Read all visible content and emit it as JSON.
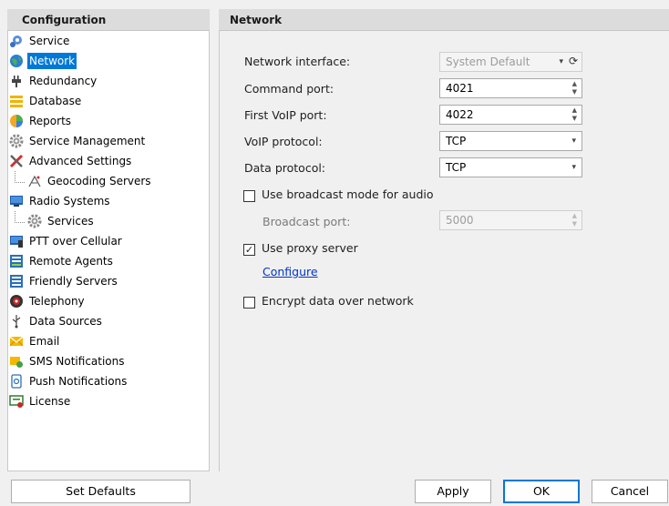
{
  "left_panel": {
    "title": "Configuration",
    "items": [
      {
        "label": "Service",
        "icon": "service-gear-icon"
      },
      {
        "label": "Network",
        "icon": "globe-icon",
        "selected": true
      },
      {
        "label": "Redundancy",
        "icon": "plug-icon"
      },
      {
        "label": "Database",
        "icon": "database-icon"
      },
      {
        "label": "Reports",
        "icon": "reports-icon"
      },
      {
        "label": "Service Management",
        "icon": "gear-icon"
      },
      {
        "label": "Advanced Settings",
        "icon": "tools-icon"
      },
      {
        "label": "Geocoding Servers",
        "icon": "geocoding-icon"
      },
      {
        "label": "Radio Systems",
        "icon": "radio-icon"
      },
      {
        "label": "Services",
        "icon": "gear-icon"
      },
      {
        "label": "PTT over Cellular",
        "icon": "cellular-icon"
      },
      {
        "label": "Remote Agents",
        "icon": "agent-icon"
      },
      {
        "label": "Friendly Servers",
        "icon": "server-icon"
      },
      {
        "label": "Telephony",
        "icon": "telephone-icon"
      },
      {
        "label": "Data Sources",
        "icon": "usb-icon"
      },
      {
        "label": "Email",
        "icon": "email-icon"
      },
      {
        "label": "SMS Notifications",
        "icon": "sms-icon"
      },
      {
        "label": "Push Notifications",
        "icon": "push-icon"
      },
      {
        "label": "License",
        "icon": "license-icon"
      }
    ]
  },
  "right_panel": {
    "title": "Network",
    "network_interface": {
      "label": "Network interface:",
      "value": "System Default"
    },
    "command_port": {
      "label": "Command port:",
      "value": "4021"
    },
    "first_voip_port": {
      "label": "First VoIP port:",
      "value": "4022"
    },
    "voip_protocol": {
      "label": "VoIP protocol:",
      "value": "TCP"
    },
    "data_protocol": {
      "label": "Data protocol:",
      "value": "TCP"
    },
    "broadcast_mode": {
      "label": "Use broadcast mode for audio",
      "checked": false
    },
    "broadcast_port": {
      "label": "Broadcast port:",
      "value": "5000"
    },
    "proxy_server": {
      "label": "Use proxy server",
      "checked": true
    },
    "configure_link": "Configure",
    "encrypt": {
      "label": "Encrypt data over network",
      "checked": false
    }
  },
  "buttons": {
    "set_defaults": "Set Defaults",
    "apply": "Apply",
    "ok": "OK",
    "cancel": "Cancel"
  },
  "glyphs": {
    "check": "✓",
    "dropdown": "▾",
    "refresh": "⟳",
    "spin": "▴▾"
  }
}
